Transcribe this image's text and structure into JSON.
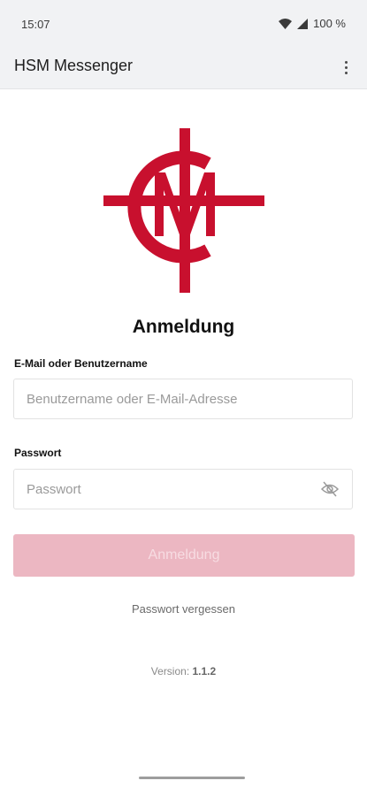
{
  "status_bar": {
    "time": "15:07",
    "battery": "100 %"
  },
  "app_bar": {
    "title": "HSM Messenger"
  },
  "login": {
    "heading": "Anmeldung",
    "username_label": "E-Mail oder Benutzername",
    "username_placeholder": "Benutzername oder E-Mail-Adresse",
    "password_label": "Passwort",
    "password_placeholder": "Passwort",
    "submit_label": "Anmeldung",
    "forgot_password": "Passwort vergessen",
    "version_label": "Version:",
    "version_number": "1.1.2"
  },
  "colors": {
    "brand_red": "#c8102e",
    "button_disabled": "#ecb7c2",
    "app_bar_bg": "#f1f2f4"
  },
  "icons": [
    "wifi-icon",
    "signal-icon",
    "overflow-menu-icon",
    "eye-off-icon",
    "hsm-logo"
  ]
}
